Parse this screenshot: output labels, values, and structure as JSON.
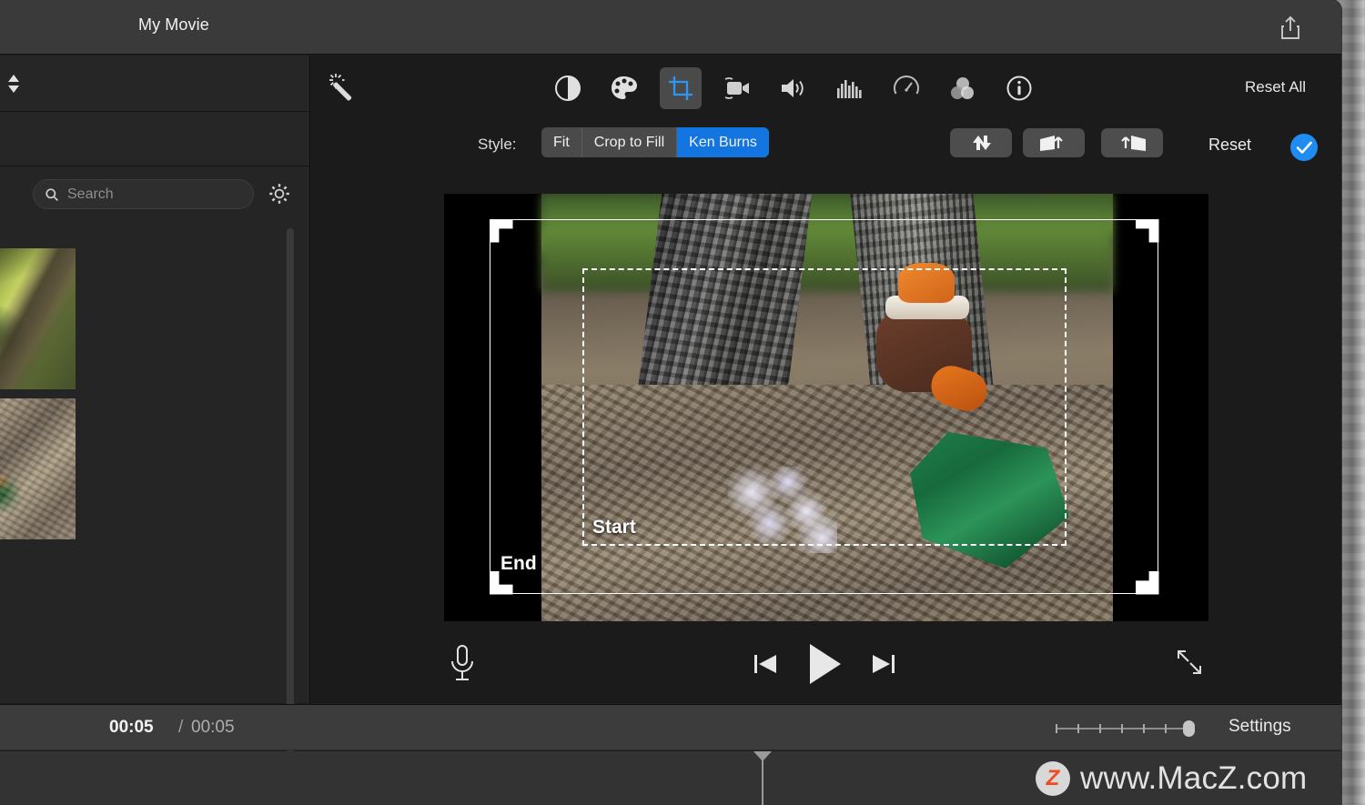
{
  "window": {
    "project_title": "My Movie",
    "share_icon": "share-icon"
  },
  "library": {
    "sort_icon": "sort-stepper-icon",
    "search": {
      "icon": "search-icon",
      "value": "",
      "placeholder": "Search"
    },
    "settings_icon": "gear-icon",
    "thumbnails": [
      {
        "name": "clip-thumbnail-1"
      },
      {
        "name": "clip-thumbnail-2"
      }
    ]
  },
  "inspector": {
    "auto_enhance_icon": "magic-wand-icon",
    "tools": [
      {
        "id": "balance",
        "icon": "color-balance-icon",
        "selected": false
      },
      {
        "id": "color",
        "icon": "color-palette-icon",
        "selected": false
      },
      {
        "id": "crop",
        "icon": "crop-icon",
        "selected": true
      },
      {
        "id": "stabilize",
        "icon": "video-camera-icon",
        "selected": false
      },
      {
        "id": "volume",
        "icon": "speaker-icon",
        "selected": false
      },
      {
        "id": "eq",
        "icon": "equalizer-icon",
        "selected": false
      },
      {
        "id": "speed",
        "icon": "speedometer-icon",
        "selected": false
      },
      {
        "id": "filter",
        "icon": "filter-circles-icon",
        "selected": false
      },
      {
        "id": "info",
        "icon": "info-icon",
        "selected": false
      }
    ],
    "reset_all_label": "Reset All",
    "style_label": "Style:",
    "style_options": [
      "Fit",
      "Crop to Fill",
      "Ken Burns"
    ],
    "style_selected": "Ken Burns",
    "action_buttons": [
      {
        "id": "swap",
        "icon": "swap-arrows-icon"
      },
      {
        "id": "start-crop",
        "icon": "crop-start-icon"
      },
      {
        "id": "end-crop",
        "icon": "crop-end-icon"
      }
    ],
    "reset_label": "Reset",
    "apply_icon": "checkmark-apply-icon",
    "accent_color": "#1275e0"
  },
  "viewer": {
    "start_label": "Start",
    "end_label": "End",
    "controls": {
      "record_voiceover_icon": "microphone-icon",
      "previous_icon": "skip-previous-icon",
      "play_icon": "play-icon",
      "next_icon": "skip-next-icon",
      "fullscreen_icon": "fullscreen-icon"
    }
  },
  "status_bar": {
    "current_time": "00:05",
    "separator": "/",
    "total_time": "00:05",
    "zoom_slider_value": 92,
    "settings_label": "Settings"
  },
  "watermark": {
    "badge_letter": "Z",
    "text": "www.MacZ.com",
    "badge_color": "#f04a23"
  }
}
